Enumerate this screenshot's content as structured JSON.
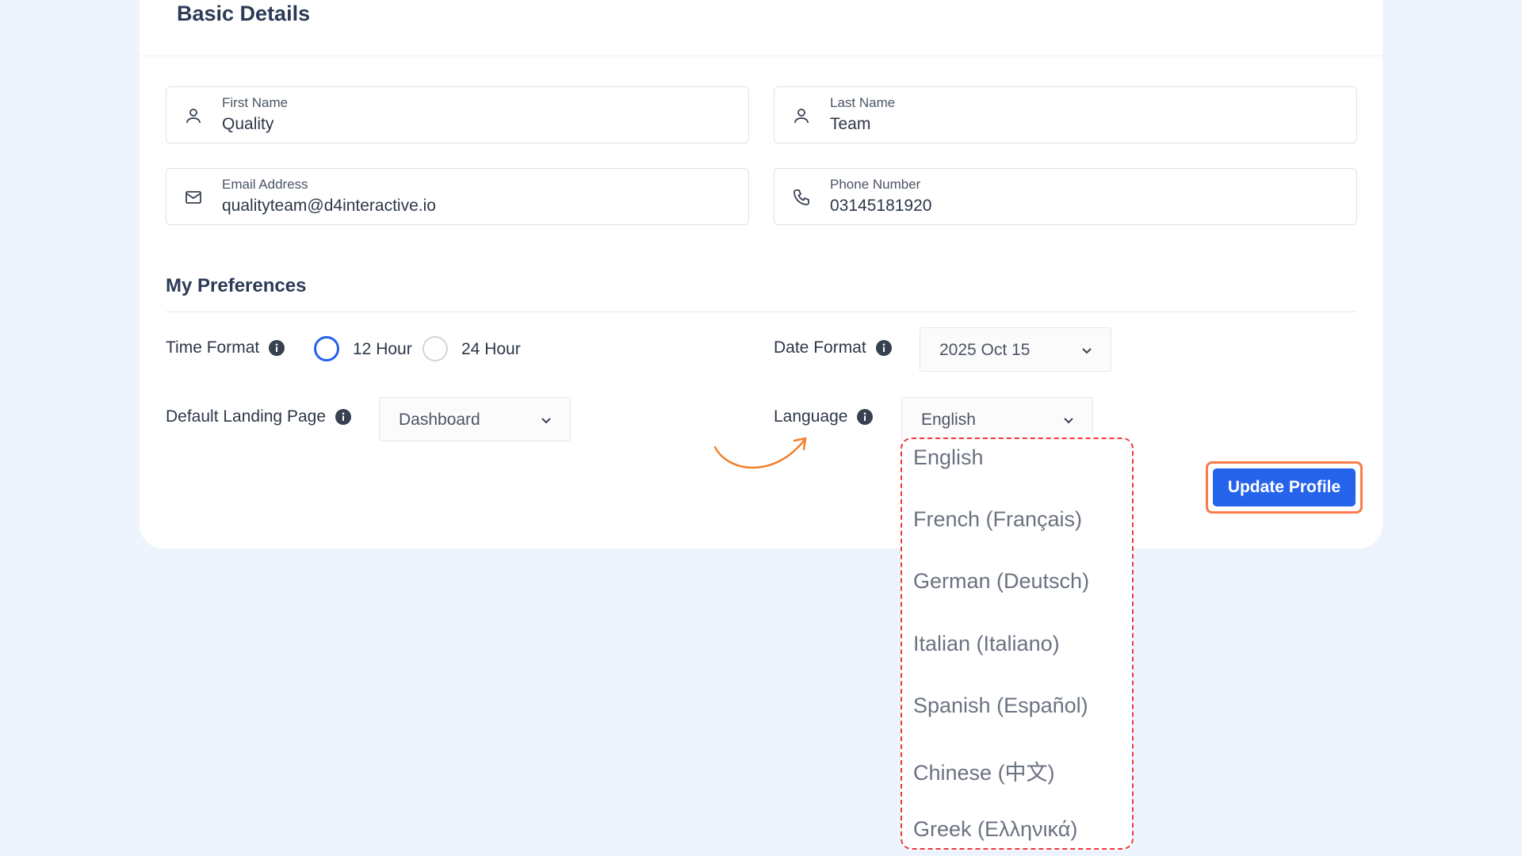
{
  "basic_details": {
    "title": "Basic Details",
    "first_name": {
      "label": "First Name",
      "value": "Quality"
    },
    "last_name": {
      "label": "Last Name",
      "value": "Team"
    },
    "email": {
      "label": "Email Address",
      "value": "qualityteam@d4interactive.io"
    },
    "phone": {
      "label": "Phone Number",
      "value": "03145181920"
    }
  },
  "preferences": {
    "title": "My Preferences",
    "time_format": {
      "label": "Time Format",
      "option_12": "12 Hour",
      "option_24": "24 Hour",
      "selected": "12 Hour"
    },
    "date_format": {
      "label": "Date Format",
      "value": "2025 Oct 15"
    },
    "landing_page": {
      "label": "Default Landing Page",
      "value": "Dashboard"
    },
    "language": {
      "label": "Language",
      "value": "English",
      "options": [
        "English",
        "French (Français)",
        "German (Deutsch)",
        "Italian (Italiano)",
        "Spanish (Español)",
        "Chinese (中文)",
        "Greek (Ελληνικά)"
      ]
    }
  },
  "actions": {
    "update_label": "Update Profile"
  },
  "colors": {
    "primary": "#2563eb",
    "highlight_border": "#f97c4a",
    "dropdown_border": "#ee3a3a",
    "annotation_arrow": "#f07f2c",
    "background": "#eef4fe"
  },
  "icons": {
    "name_field": "user-icon",
    "email_field": "mail-icon",
    "phone_field": "phone-icon",
    "info": "info-icon",
    "chevron": "chevron-down-icon",
    "annotation": "curved-arrow-icon"
  }
}
